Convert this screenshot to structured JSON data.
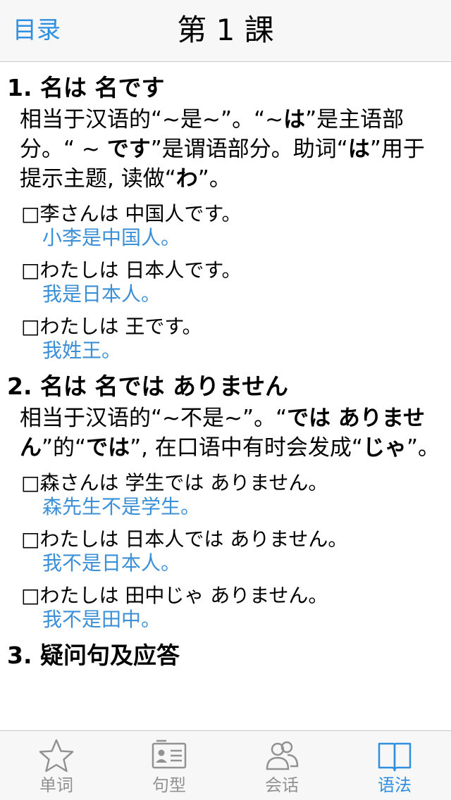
{
  "nav": {
    "back_label": "目录",
    "title": "第 1 課"
  },
  "sections": [
    {
      "heading": "1. 名は  名です",
      "body": [
        {
          "t": "相当于汉语的“~是~”。“~"
        },
        {
          "t": "は",
          "b": true
        },
        {
          "t": "”是主语部分。“ ~ "
        },
        {
          "t": "です",
          "b": true
        },
        {
          "t": "”是谓语部分。助词“"
        },
        {
          "t": "は",
          "b": true
        },
        {
          "t": "”用于提示主题, 读做“"
        },
        {
          "t": "わ",
          "b": true
        },
        {
          "t": "”。"
        }
      ],
      "examples": [
        {
          "jp": "□李さんは  中国人です。",
          "cn": "小李是中国人。"
        },
        {
          "jp": "□わたしは  日本人です。",
          "cn": "我是日本人。"
        },
        {
          "jp": "□わたしは  王です。",
          "cn": "我姓王。"
        }
      ]
    },
    {
      "heading": "2. 名は  名では  ありません",
      "body": [
        {
          "t": "相当于汉语的“~不是~”。“"
        },
        {
          "t": "では ありません",
          "b": true
        },
        {
          "t": "”的“"
        },
        {
          "t": "では",
          "b": true
        },
        {
          "t": "”, 在口语中有时会发成“"
        },
        {
          "t": "じゃ",
          "b": true
        },
        {
          "t": "”。"
        }
      ],
      "examples": [
        {
          "jp": "□森さんは  学生では  ありません。",
          "cn": "森先生不是学生。"
        },
        {
          "jp": "□わたしは  日本人では  ありません。",
          "cn": "我不是日本人。"
        },
        {
          "jp": "□わたしは  田中じゃ  ありません。",
          "cn": "我不是田中。"
        }
      ]
    },
    {
      "heading": "3. 疑问句及应答",
      "body": [],
      "examples": []
    }
  ],
  "tabbar": {
    "tabs": [
      {
        "label": "单词",
        "icon": "star-icon",
        "active": false
      },
      {
        "label": "句型",
        "icon": "id-card-icon",
        "active": false
      },
      {
        "label": "会话",
        "icon": "people-icon",
        "active": false
      },
      {
        "label": "语法",
        "icon": "book-icon",
        "active": true
      }
    ]
  },
  "colors": {
    "accent": "#2f8fe0",
    "translation": "#3b8fd6",
    "inactive": "#929292"
  }
}
